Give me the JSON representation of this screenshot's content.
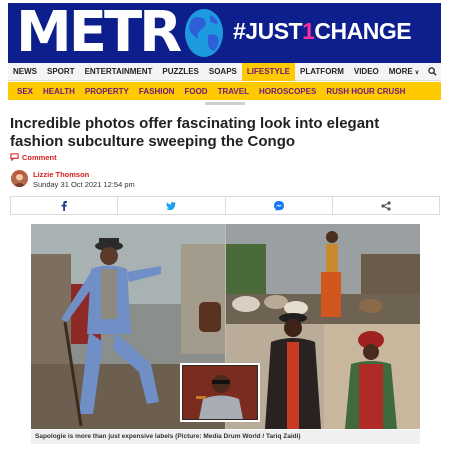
{
  "brand": {
    "logo": "METR",
    "campaign_prefix": "#JUST",
    "campaign_number": "1",
    "campaign_suffix": "CHANGE"
  },
  "nav": {
    "items": [
      {
        "label": "NEWS"
      },
      {
        "label": "SPORT"
      },
      {
        "label": "ENTERTAINMENT"
      },
      {
        "label": "PUZZLES"
      },
      {
        "label": "SOAPS"
      },
      {
        "label": "LIFESTYLE"
      },
      {
        "label": "PLATFORM"
      },
      {
        "label": "VIDEO"
      }
    ],
    "more_label": "MORE",
    "active": "LIFESTYLE"
  },
  "subnav": {
    "items": [
      {
        "label": "SEX"
      },
      {
        "label": "HEALTH"
      },
      {
        "label": "PROPERTY"
      },
      {
        "label": "FASHION"
      },
      {
        "label": "FOOD"
      },
      {
        "label": "TRAVEL"
      },
      {
        "label": "HOROSCOPES"
      },
      {
        "label": "RUSH HOUR CRUSH"
      }
    ]
  },
  "article": {
    "headline": "Incredible photos offer fascinating look into elegant fashion subculture sweeping the Congo",
    "comment_label": "Comment",
    "author": "Lizzie Thomson",
    "date": "Sunday 31 Oct 2021 12:54 pm",
    "caption": "Sapologie is more than just expensive labels (Picture: Media Drum World / Tariq Zaidi)"
  },
  "share": {
    "buttons": [
      "facebook-icon",
      "twitter-icon",
      "messenger-icon",
      "share-icon"
    ]
  },
  "colors": {
    "brand_blue": "#0d1f8c",
    "accent_yellow": "#ffc900",
    "lifestyle_purple": "#6a1a7e",
    "link_red": "#d31e1e",
    "one_pink": "#ff2d9b"
  }
}
